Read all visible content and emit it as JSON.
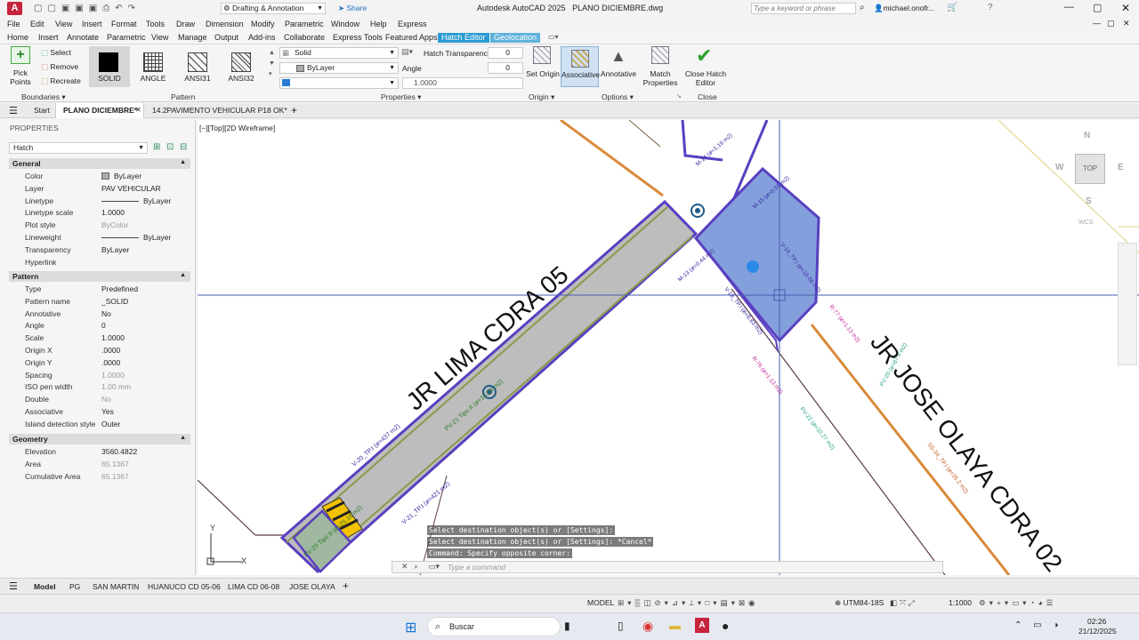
{
  "title_bar": {
    "app_title": "Autodesk AutoCAD 2025",
    "doc_title": "PLANO DICIEMBRE.dwg",
    "workspace": "Drafting & Annotation",
    "share": "Share",
    "search_placeholder": "Type a keyword or phrase",
    "user": "michael.onofr..."
  },
  "menu": [
    "File",
    "Edit",
    "View",
    "Insert",
    "Format",
    "Tools",
    "Draw",
    "Dimension",
    "Modify",
    "Parametric",
    "Window",
    "Help",
    "Express"
  ],
  "ribbon_tabs": [
    "Home",
    "Insert",
    "Annotate",
    "Parametric",
    "View",
    "Manage",
    "Output",
    "Add-ins",
    "Collaborate",
    "Express Tools",
    "Featured Apps",
    "Hatch Editor",
    "Geolocation"
  ],
  "ribbon": {
    "boundaries": {
      "pick_points": "Pick Points",
      "select": "Select",
      "remove": "Remove",
      "recreate": "Recreate",
      "label": "Boundaries"
    },
    "pattern": {
      "items": [
        "SOLID",
        "ANGLE",
        "ANSI31",
        "ANSI32"
      ],
      "label": "Pattern"
    },
    "properties": {
      "type": "Solid",
      "color": "ByLayer",
      "transparency_label": "Hatch Transparency",
      "transparency_value": "0",
      "angle_label": "Angle",
      "angle_value": "0",
      "scale_value": "1.0000",
      "label": "Properties"
    },
    "origin": {
      "set_origin": "Set Origin",
      "label": "Origin"
    },
    "options": {
      "associative": "Associative",
      "annotative": "Annotative",
      "match_properties": "Match Properties",
      "label": "Options"
    },
    "close": {
      "close_hatch_editor": "Close Hatch Editor",
      "label": "Close"
    }
  },
  "doc_tabs": [
    "Start",
    "PLANO DICIEMBRE*",
    "14.2PAVIMENTO VEHICULAR P18 OK*"
  ],
  "properties_panel": {
    "title": "PROPERTIES",
    "object_type": "Hatch",
    "sections": [
      {
        "name": "General",
        "rows": [
          [
            "Color",
            "ByLayer"
          ],
          [
            "Layer",
            "PAV VEHICULAR"
          ],
          [
            "Linetype",
            "ByLayer"
          ],
          [
            "Linetype scale",
            "1.0000"
          ],
          [
            "Plot style",
            "ByColor"
          ],
          [
            "Lineweight",
            "ByLayer"
          ],
          [
            "Transparency",
            "ByLayer"
          ],
          [
            "Hyperlink",
            ""
          ]
        ]
      },
      {
        "name": "Pattern",
        "rows": [
          [
            "Type",
            "Predefined"
          ],
          [
            "Pattern name",
            "_SOLID"
          ],
          [
            "Annotative",
            "No"
          ],
          [
            "Angle",
            "0"
          ],
          [
            "Scale",
            "1.0000"
          ],
          [
            "Origin X",
            ".0000"
          ],
          [
            "Origin Y",
            ".0000"
          ],
          [
            "Spacing",
            "1.0000"
          ],
          [
            "ISO pen width",
            "1.00 mm"
          ],
          [
            "Double",
            "No"
          ],
          [
            "Associative",
            "Yes"
          ],
          [
            "Island detection style",
            "Outer"
          ]
        ]
      },
      {
        "name": "Geometry",
        "rows": [
          [
            "Elevation",
            "3560.4822"
          ],
          [
            "Area",
            "65.1367"
          ],
          [
            "Cumulative Area",
            "65.1367"
          ]
        ]
      }
    ]
  },
  "viewport": {
    "label": "[−][Top][2D Wireframe]",
    "street_1": "JR LIMA CDRA 05",
    "street_2": "JR JOSE OLAYA CDRA 02",
    "viewcube": {
      "top": "TOP",
      "n": "N",
      "s": "S",
      "e": "E",
      "w": "W",
      "wcs": "WCS"
    },
    "ucs": {
      "x": "X",
      "y": "Y"
    },
    "annotations": [
      "V-20_TP.I (ø=437 m2)",
      "PV-21 Tipo II (ø=16.93 m2)",
      "V-21_TP.I (ø=421 m2)",
      "PV-20 Tipo II (ø=25.16 m2)",
      "M-14 (ø=1.19 m2)",
      "M-15 (ø=0.55 m2)",
      "M-13 (ø=0.44 m2)",
      "V-18_TP.I (ø=8.83 m2)",
      "V-19_TP.I (ø=16.08 m2)",
      "R-77 (ø=1.13 m2)",
      "R-76 (ø=1.13 m2)",
      "PV-22 (ø=10.27 m2)",
      "PV-20 (ø=87.4 m2)",
      "SS-34_TP.I (ø=26.2 m2)"
    ]
  },
  "command_line": {
    "history": [
      "Select destination object(s) or [Settings]:",
      "Select destination object(s) or [Settings]: *Cancel*",
      "Command: Specify opposite corner:"
    ],
    "placeholder": "Type a command"
  },
  "layout_tabs": [
    "Model",
    "PG",
    "SAN MARTIN",
    "HUANUCO CD 05-06",
    "LIMA CD 06-08",
    "JOSE OLAYA"
  ],
  "status": {
    "model": "MODEL",
    "coord_system": "UTM84-18S",
    "scale": "1:1000"
  },
  "taskbar": {
    "search": "Buscar",
    "time": "02:26",
    "date": "21/12/2025"
  },
  "colors": {
    "accent": "#2b9bd3",
    "hatch_blue": "#6f8fd6",
    "boundary": "#5a3fc0",
    "street_orange": "#d98a3a",
    "pavement": "#bdbdbd"
  }
}
